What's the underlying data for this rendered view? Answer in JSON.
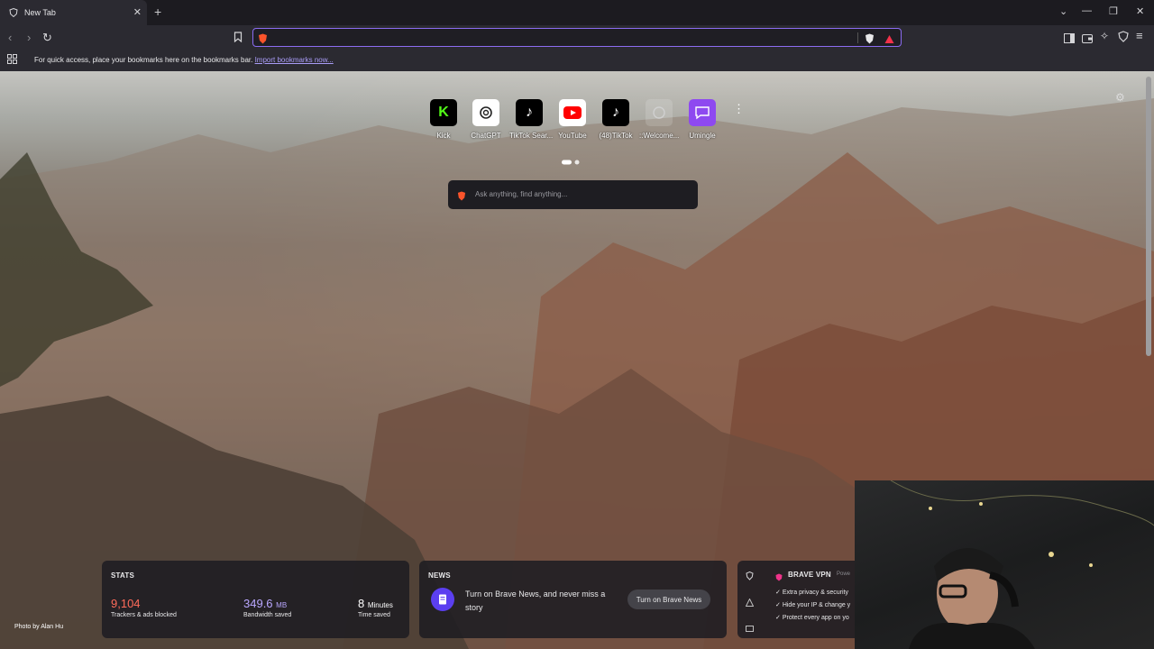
{
  "tab": {
    "title": "New Tab"
  },
  "bookmarks_bar": {
    "message": "For quick access, place your bookmarks here on the bookmarks bar.",
    "import_link": "Import bookmarks now..."
  },
  "top_sites": [
    {
      "label": "Kick",
      "icon": "kick-icon",
      "color": "#53fc18"
    },
    {
      "label": "ChatGPT",
      "icon": "chatgpt-icon",
      "color": "#ffffff"
    },
    {
      "label": "TikTok Sear...",
      "icon": "tiktok-icon",
      "color": "#000000"
    },
    {
      "label": "YouTube",
      "icon": "youtube-icon",
      "color": "#ffffff"
    },
    {
      "label": "(48)TikTok",
      "icon": "tiktok-icon",
      "color": "#000000"
    },
    {
      "label": "::Welcome...",
      "icon": "globe-icon",
      "color": "#bdbdbd"
    },
    {
      "label": "Umingle",
      "icon": "chat-bubble-icon",
      "color": "#8e49f0"
    }
  ],
  "search": {
    "placeholder": "Ask anything, find anything..."
  },
  "stats": {
    "header": "STATS",
    "trackers_value": "9,104",
    "trackers_label": "Trackers & ads blocked",
    "bandwidth_value": "349.6",
    "bandwidth_unit": "MB",
    "bandwidth_label": "Bandwidth saved",
    "time_value": "8",
    "time_unit": "Minutes",
    "time_label": "Time saved"
  },
  "news": {
    "header": "NEWS",
    "message": "Turn on Brave News, and never miss a story",
    "button": "Turn on Brave News"
  },
  "vpn": {
    "header": "BRAVE VPN",
    "powered": "Powe",
    "items": [
      "Extra privacy & security",
      "Hide your IP & change y",
      "Protect every app on yo"
    ]
  },
  "photo_credit": "Photo by Alan Hu",
  "colors": {
    "accent": "#8b6cf2",
    "stat_red": "#ff6b5a",
    "stat_purple": "#b9a7ff"
  }
}
